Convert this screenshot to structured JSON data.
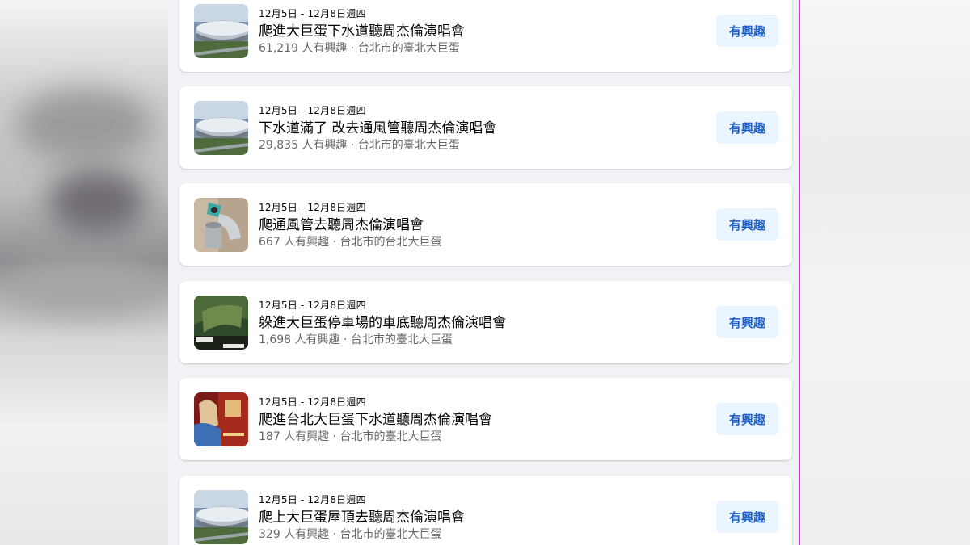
{
  "events": [
    {
      "date": "12月5日 - 12月8日週四",
      "title": "爬進大巨蛋下水道聽周杰倫演唱會",
      "meta": "61,219 人有興趣 · 台北市的臺北大巨蛋",
      "button": "有興趣",
      "thumbnail": "dome-photo"
    },
    {
      "date": "12月5日 - 12月8日週四",
      "title": "下水道滿了 改去通風管聽周杰倫演唱會",
      "meta": "29,835 人有興趣 · 台北市的臺北大巨蛋",
      "button": "有興趣",
      "thumbnail": "dome-photo"
    },
    {
      "date": "12月5日 - 12月8日週四",
      "title": "爬通風管去聽周杰倫演唱會",
      "meta": "667 人有興趣 · 台北市的台北大巨蛋",
      "button": "有興趣",
      "thumbnail": "air-duct-photo"
    },
    {
      "date": "12月5日 - 12月8日週四",
      "title": "躲進大巨蛋停車場的車底聽周杰倫演唱會",
      "meta": "1,698 人有興趣 · 台北市的臺北大巨蛋",
      "button": "有興趣",
      "thumbnail": "car-underside-photo"
    },
    {
      "date": "12月5日 - 12月8日週四",
      "title": "爬進台北大巨蛋下水道聽周杰倫演唱會",
      "meta": "187 人有興趣 · 台北市的臺北大巨蛋",
      "button": "有興趣",
      "thumbnail": "concert-poster"
    },
    {
      "date": "12月5日 - 12月8日週四",
      "title": "爬上大巨蛋屋頂去聽周杰倫演唱會",
      "meta": "329 人有興趣 · 台北市的臺北大巨蛋",
      "button": "有興趣",
      "thumbnail": "dome-photo"
    }
  ],
  "colors": {
    "feed_background": "#f0f2f5",
    "card_background": "#ffffff",
    "button_background": "#ebf5ff",
    "button_text": "#1d61c9",
    "meta_text": "#65676b",
    "accent_line": "#d63bd6"
  }
}
